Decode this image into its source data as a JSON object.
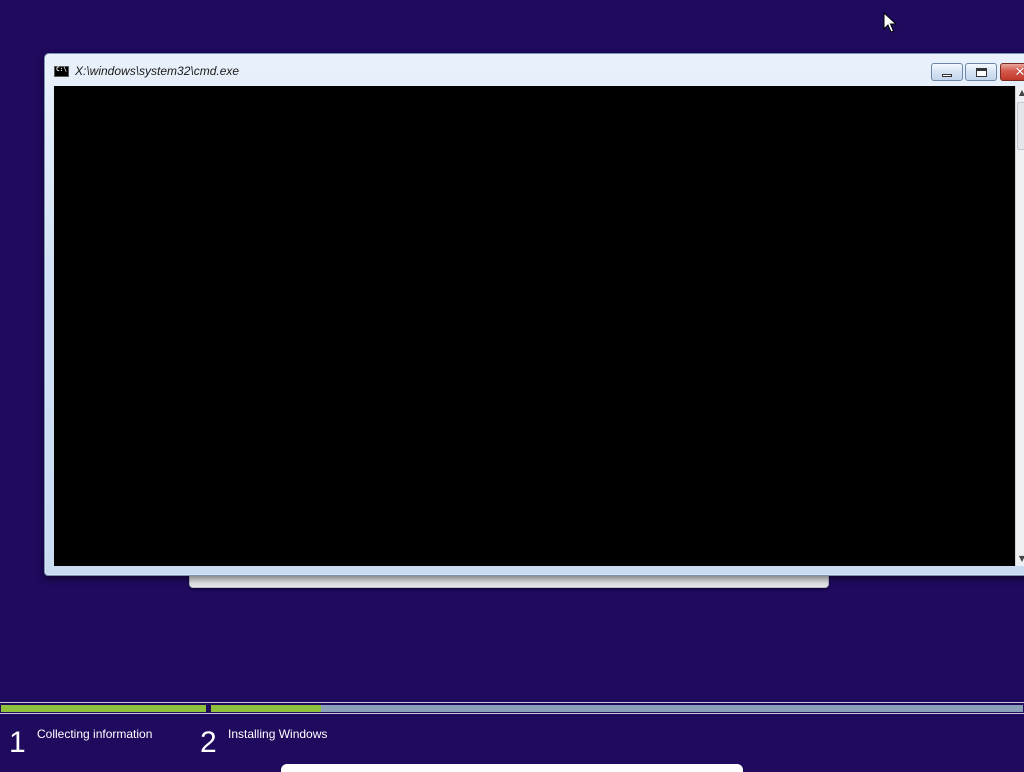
{
  "window": {
    "title": "X:\\windows\\system32\\cmd.exe",
    "icon": "cmd-icon",
    "buttons": {
      "minimize_icon": "minimize-icon",
      "maximize_icon": "maximize-icon",
      "close_glyph": "✕"
    },
    "console_text": ""
  },
  "setup_steps": [
    {
      "number": "1",
      "label": "Collecting information",
      "progress": 1.0
    },
    {
      "number": "2",
      "label": "Installing Windows",
      "progress": 0.135
    }
  ],
  "colors": {
    "background": "#1f0a5e",
    "progress_complete": "#8fc13c",
    "progress_remaining": "#8aa0b8",
    "close_button": "#c0392b"
  }
}
